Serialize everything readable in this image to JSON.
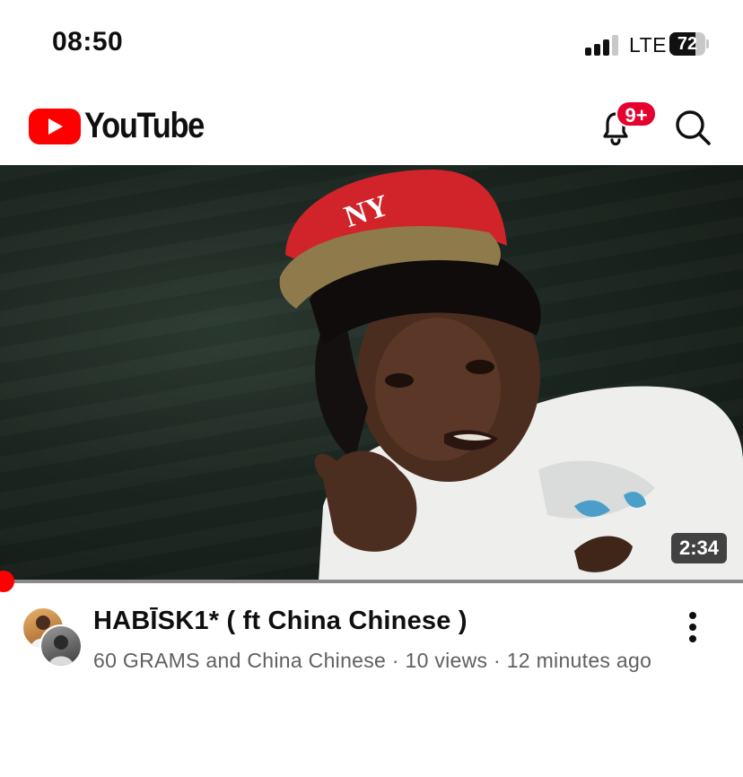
{
  "status_bar": {
    "time": "08:50",
    "network": "LTE",
    "battery_level": "72",
    "signal_strength": 0.75
  },
  "header": {
    "logo_text": "YouTube",
    "notification_badge": "9+",
    "icons": [
      "youtube-play-icon",
      "bell-icon",
      "search-icon"
    ]
  },
  "video": {
    "duration": "2:34",
    "progress": 0.0,
    "title": "HABĪSK1* ( ft China Chinese )",
    "meta_line": "60 GRAMS  and China Chinese · 10 views · 12 minutes ago"
  },
  "colors": {
    "brand_red": "#ff0000",
    "badge_red": "#e5002d",
    "meta_gray": "#606060"
  }
}
